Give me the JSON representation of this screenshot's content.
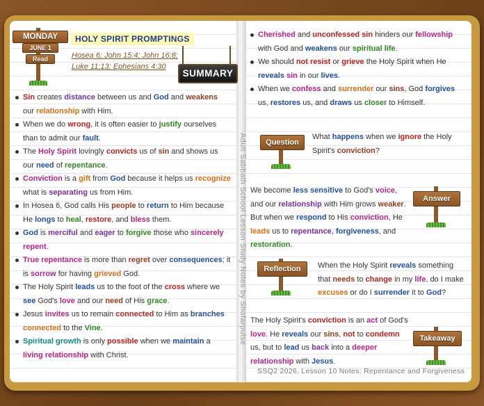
{
  "date": {
    "day": "MONDAY",
    "month_day": "JUNE 1",
    "action": "Read"
  },
  "heading": "HOLY SPIRIT PROMPTINGS",
  "references": [
    "Hosea 6; John 15:4; John 16:8;",
    "Luke 11:13; Ephesians 4:30"
  ],
  "summary_sign": "SUMMARY",
  "spine_text": "Adult Sabbath School Lesson Study Notes by Shofarpulse",
  "footer": "SSQ2 2026, Lesson 10 Notes: Repentance and Forgiveness",
  "colors": {
    "red": "#c4201b",
    "blue": "#1f4fa8",
    "green": "#2f8a1f",
    "magenta": "#c0208a",
    "orange": "#e06d10",
    "purple": "#7a2ea8",
    "brown": "#9b3b1b",
    "teal": "#138a8a"
  },
  "left_bullets": [
    [
      [
        "Sin",
        "r"
      ],
      [
        " creates ",
        ""
      ],
      [
        "distance",
        "p"
      ],
      [
        " between us and ",
        ""
      ],
      [
        "God",
        "b"
      ],
      [
        " and ",
        ""
      ],
      [
        "weakens",
        "br"
      ],
      [
        " our ",
        ""
      ],
      [
        "relationship",
        "o"
      ],
      [
        " with Him.",
        ""
      ]
    ],
    [
      [
        "When we do ",
        ""
      ],
      [
        "wrong",
        "r"
      ],
      [
        ", it is often easier to ",
        ""
      ],
      [
        "justify",
        "g"
      ],
      [
        " ourselves than to admit our ",
        ""
      ],
      [
        "fault",
        "b"
      ],
      [
        ".",
        ""
      ]
    ],
    [
      [
        "The ",
        ""
      ],
      [
        "Holy Spirit",
        "m"
      ],
      [
        " lovingly ",
        ""
      ],
      [
        "convicts",
        "r"
      ],
      [
        " us of ",
        ""
      ],
      [
        "sin",
        "br"
      ],
      [
        " and shows us our ",
        ""
      ],
      [
        "need",
        "b"
      ],
      [
        " of ",
        ""
      ],
      [
        "repentance",
        "g"
      ],
      [
        ".",
        ""
      ]
    ],
    [
      [
        "Conviction",
        "m"
      ],
      [
        " is a ",
        ""
      ],
      [
        "gift",
        "o"
      ],
      [
        " from ",
        ""
      ],
      [
        "God",
        "b"
      ],
      [
        " because it helps us ",
        ""
      ],
      [
        "recognize",
        "o"
      ],
      [
        " what is ",
        ""
      ],
      [
        "separating",
        "p"
      ],
      [
        " us from Him.",
        ""
      ]
    ],
    [
      [
        "In Hosea 6, God calls His ",
        ""
      ],
      [
        "people",
        "br"
      ],
      [
        " to ",
        ""
      ],
      [
        "return",
        "b"
      ],
      [
        " to Him because He ",
        ""
      ],
      [
        "longs",
        "b"
      ],
      [
        " to ",
        ""
      ],
      [
        "heal",
        "g"
      ],
      [
        ", ",
        ""
      ],
      [
        "restore",
        "r"
      ],
      [
        ", and ",
        ""
      ],
      [
        "bless",
        "m"
      ],
      [
        " them.",
        ""
      ]
    ],
    [
      [
        "God",
        "b"
      ],
      [
        " is ",
        ""
      ],
      [
        "merciful",
        "p"
      ],
      [
        " and ",
        ""
      ],
      [
        "eager",
        "p"
      ],
      [
        " to ",
        ""
      ],
      [
        "forgive",
        "g"
      ],
      [
        " those who ",
        ""
      ],
      [
        "sincerely repent",
        "m"
      ],
      [
        ".",
        ""
      ]
    ],
    [
      [
        "True repentance",
        "m"
      ],
      [
        " is more than ",
        ""
      ],
      [
        "regret",
        "br"
      ],
      [
        " over ",
        ""
      ],
      [
        "consequences",
        "b"
      ],
      [
        "; it is ",
        ""
      ],
      [
        "sorrow",
        "m"
      ],
      [
        " for having ",
        ""
      ],
      [
        "grieved",
        "o"
      ],
      [
        " God.",
        ""
      ]
    ],
    [
      [
        "The Holy Spirit ",
        ""
      ],
      [
        "leads",
        "b"
      ],
      [
        " us to the foot of the ",
        ""
      ],
      [
        "cross",
        "r"
      ],
      [
        " where we ",
        ""
      ],
      [
        "see",
        "b"
      ],
      [
        " God's ",
        ""
      ],
      [
        "love",
        "m"
      ],
      [
        " and our ",
        ""
      ],
      [
        "need",
        "br"
      ],
      [
        " of His ",
        ""
      ],
      [
        "grace",
        "g"
      ],
      [
        ".",
        ""
      ]
    ],
    [
      [
        "Jesus ",
        ""
      ],
      [
        "invites",
        "m"
      ],
      [
        " us to remain ",
        ""
      ],
      [
        "connected",
        "r"
      ],
      [
        " to Him as ",
        ""
      ],
      [
        "branches",
        "b"
      ],
      [
        " ",
        ""
      ],
      [
        "connected",
        "o"
      ],
      [
        " to the ",
        ""
      ],
      [
        "Vine",
        "g"
      ],
      [
        ".",
        ""
      ]
    ],
    [
      [
        "Spiritual growth",
        "t"
      ],
      [
        " is only ",
        ""
      ],
      [
        "possible",
        "r"
      ],
      [
        " when we ",
        ""
      ],
      [
        "maintain",
        "b"
      ],
      [
        " a ",
        ""
      ],
      [
        "living relationship",
        "m"
      ],
      [
        " with Christ.",
        ""
      ]
    ]
  ],
  "right_bullets": [
    [
      [
        "Cherished",
        "m"
      ],
      [
        " and ",
        ""
      ],
      [
        "unconfessed sin",
        "r"
      ],
      [
        " hinders our ",
        ""
      ],
      [
        "fellowship",
        "m"
      ],
      [
        " with God and ",
        ""
      ],
      [
        "weakens",
        "b"
      ],
      [
        " our ",
        ""
      ],
      [
        "spiritual life",
        "g"
      ],
      [
        ".",
        ""
      ]
    ],
    [
      [
        "We should ",
        ""
      ],
      [
        "not resist",
        "r"
      ],
      [
        " or ",
        ""
      ],
      [
        "grieve",
        "r"
      ],
      [
        " the Holy Spirit when He ",
        ""
      ],
      [
        "reveals",
        "b"
      ],
      [
        " ",
        ""
      ],
      [
        "sin",
        "m"
      ],
      [
        " in our ",
        ""
      ],
      [
        "lives",
        "b"
      ],
      [
        ".",
        ""
      ]
    ],
    [
      [
        "When we ",
        ""
      ],
      [
        "confess",
        "m"
      ],
      [
        " and ",
        ""
      ],
      [
        "surrender",
        "o"
      ],
      [
        " our ",
        ""
      ],
      [
        "sins",
        "br"
      ],
      [
        ", God ",
        ""
      ],
      [
        "forgives",
        "b"
      ],
      [
        " us, ",
        ""
      ],
      [
        "restores",
        "b"
      ],
      [
        " us, and ",
        ""
      ],
      [
        "draws",
        "b"
      ],
      [
        " us ",
        ""
      ],
      [
        "closer",
        "g"
      ],
      [
        " to Himself.",
        ""
      ]
    ]
  ],
  "sections": {
    "question": {
      "label": "Question",
      "text": [
        [
          "What ",
          ""
        ],
        [
          "happens",
          "b"
        ],
        [
          " when we ",
          ""
        ],
        [
          "ignore",
          "r"
        ],
        [
          " the Holy Spirit's ",
          ""
        ],
        [
          "conviction",
          "br"
        ],
        [
          "?",
          ""
        ]
      ]
    },
    "answer": {
      "label": "Answer",
      "text": [
        [
          "We become ",
          ""
        ],
        [
          "less sensitive",
          "b"
        ],
        [
          " to God's ",
          ""
        ],
        [
          "voice",
          "m"
        ],
        [
          ", and our ",
          ""
        ],
        [
          "relationship",
          "p"
        ],
        [
          " with Him grows ",
          ""
        ],
        [
          "weaker",
          "br"
        ],
        [
          ". But when we ",
          ""
        ],
        [
          "respond",
          "b"
        ],
        [
          " to His ",
          ""
        ],
        [
          "conviction",
          "m"
        ],
        [
          ", He ",
          ""
        ],
        [
          "leads",
          "o"
        ],
        [
          " us to ",
          ""
        ],
        [
          "repentance",
          "p"
        ],
        [
          ", ",
          ""
        ],
        [
          "forgiveness",
          "b"
        ],
        [
          ", and ",
          ""
        ],
        [
          "restoration",
          "g"
        ],
        [
          ".",
          ""
        ]
      ]
    },
    "reflection": {
      "label": "Reflection",
      "text": [
        [
          "When the Holy Spirit ",
          ""
        ],
        [
          "reveals",
          "b"
        ],
        [
          " something that ",
          ""
        ],
        [
          "needs",
          "br"
        ],
        [
          " to ",
          ""
        ],
        [
          "change",
          "r"
        ],
        [
          " in my ",
          ""
        ],
        [
          "life",
          "m"
        ],
        [
          ", do I make ",
          ""
        ],
        [
          "excuses",
          "o"
        ],
        [
          " or do I ",
          ""
        ],
        [
          "surrender",
          "b"
        ],
        [
          " it to ",
          ""
        ],
        [
          "God",
          "b"
        ],
        [
          "?",
          ""
        ]
      ]
    },
    "takeaway": {
      "label": "Takeaway",
      "text": [
        [
          "The Holy Spirit's ",
          ""
        ],
        [
          "conviction",
          "r"
        ],
        [
          " is an ",
          ""
        ],
        [
          "act",
          "m"
        ],
        [
          " of God's ",
          ""
        ],
        [
          "love",
          "m"
        ],
        [
          ". He ",
          ""
        ],
        [
          "reveals",
          "b"
        ],
        [
          " our ",
          ""
        ],
        [
          "sins",
          "br"
        ],
        [
          ", ",
          ""
        ],
        [
          "not",
          "r"
        ],
        [
          " to ",
          ""
        ],
        [
          "condemn",
          "r"
        ],
        [
          " us, but to ",
          ""
        ],
        [
          "lead",
          "b"
        ],
        [
          " us ",
          ""
        ],
        [
          "back",
          "p"
        ],
        [
          " into a ",
          ""
        ],
        [
          "deeper relationship",
          "m"
        ],
        [
          " with ",
          ""
        ],
        [
          "Jesus",
          "b"
        ],
        [
          ".",
          ""
        ]
      ]
    }
  }
}
